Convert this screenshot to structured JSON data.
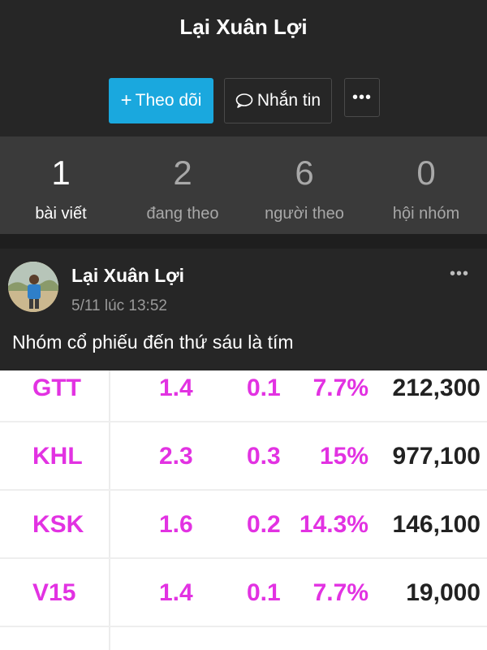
{
  "profile": {
    "name": "Lại Xuân Lợi",
    "follow_label": "Theo dõi",
    "message_label": "Nhắn tin",
    "more_label": "•••"
  },
  "stats": [
    {
      "value": "1",
      "label": "bài viết"
    },
    {
      "value": "2",
      "label": "đang theo"
    },
    {
      "value": "6",
      "label": "người theo"
    },
    {
      "value": "0",
      "label": "hội nhóm"
    }
  ],
  "post": {
    "author": "Lại Xuân Lợi",
    "time": "5/11 lúc 13:52",
    "menu_label": "•••",
    "text": "Nhóm cổ phiếu đến thứ sáu là tím"
  },
  "stock_table": {
    "rows": [
      {
        "code": "GTT",
        "price": "1.4",
        "change": "0.1",
        "pct": "7.7%",
        "volume": "212,300"
      },
      {
        "code": "KHL",
        "price": "2.3",
        "change": "0.3",
        "pct": "15%",
        "volume": "977,100"
      },
      {
        "code": "KSK",
        "price": "1.6",
        "change": "0.2",
        "pct": "14.3%",
        "volume": "146,100"
      },
      {
        "code": "V15",
        "price": "1.4",
        "change": "0.1",
        "pct": "7.7%",
        "volume": "19,000"
      }
    ]
  },
  "colors": {
    "accent": "#1aa8de",
    "ceiling_purple": "#e232e2",
    "background": "#262626"
  }
}
